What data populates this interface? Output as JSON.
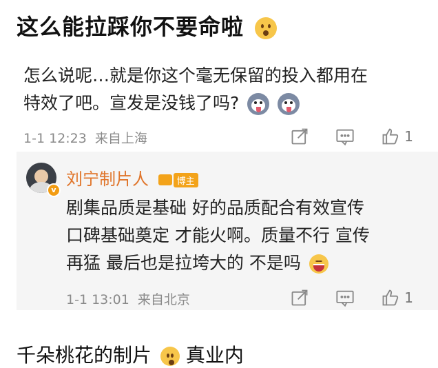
{
  "post": {
    "title": "这么能拉踩你不要命啦"
  },
  "comment": {
    "text_line1": "怎么说呢…就是你这个毫无保留的投入都用在",
    "text_line2": "特效了吧。宣发是没钱了吗?",
    "time": "1-1 12:23",
    "location": "来自上海",
    "like_count": "1"
  },
  "reply": {
    "author": "刘宁制片人",
    "author_badge": "博主",
    "verified_mark": "v",
    "text_line1": "剧集品质是基础 好的品质配合有效宣传",
    "text_line2": "口碑基础奠定 才能火啊。质量不行 宣传",
    "text_line3": "再猛 最后也是拉垮大的 不是吗",
    "time": "1-1 13:01",
    "location": "来自北京",
    "like_count": "1"
  },
  "next_comment": {
    "text_visible": "千朵桃花的制片",
    "text_after_emoji": "真业内"
  },
  "icons": [
    "surprised-emoji-icon",
    "husky-emoji-icon",
    "laugh-emoji-icon",
    "share-icon",
    "comment-icon",
    "like-icon"
  ],
  "colors": {
    "accent_name": "#e0752b",
    "badge": "#f3a31a",
    "meta": "#8a8a8a",
    "reply_bg": "#f5f5f5"
  }
}
